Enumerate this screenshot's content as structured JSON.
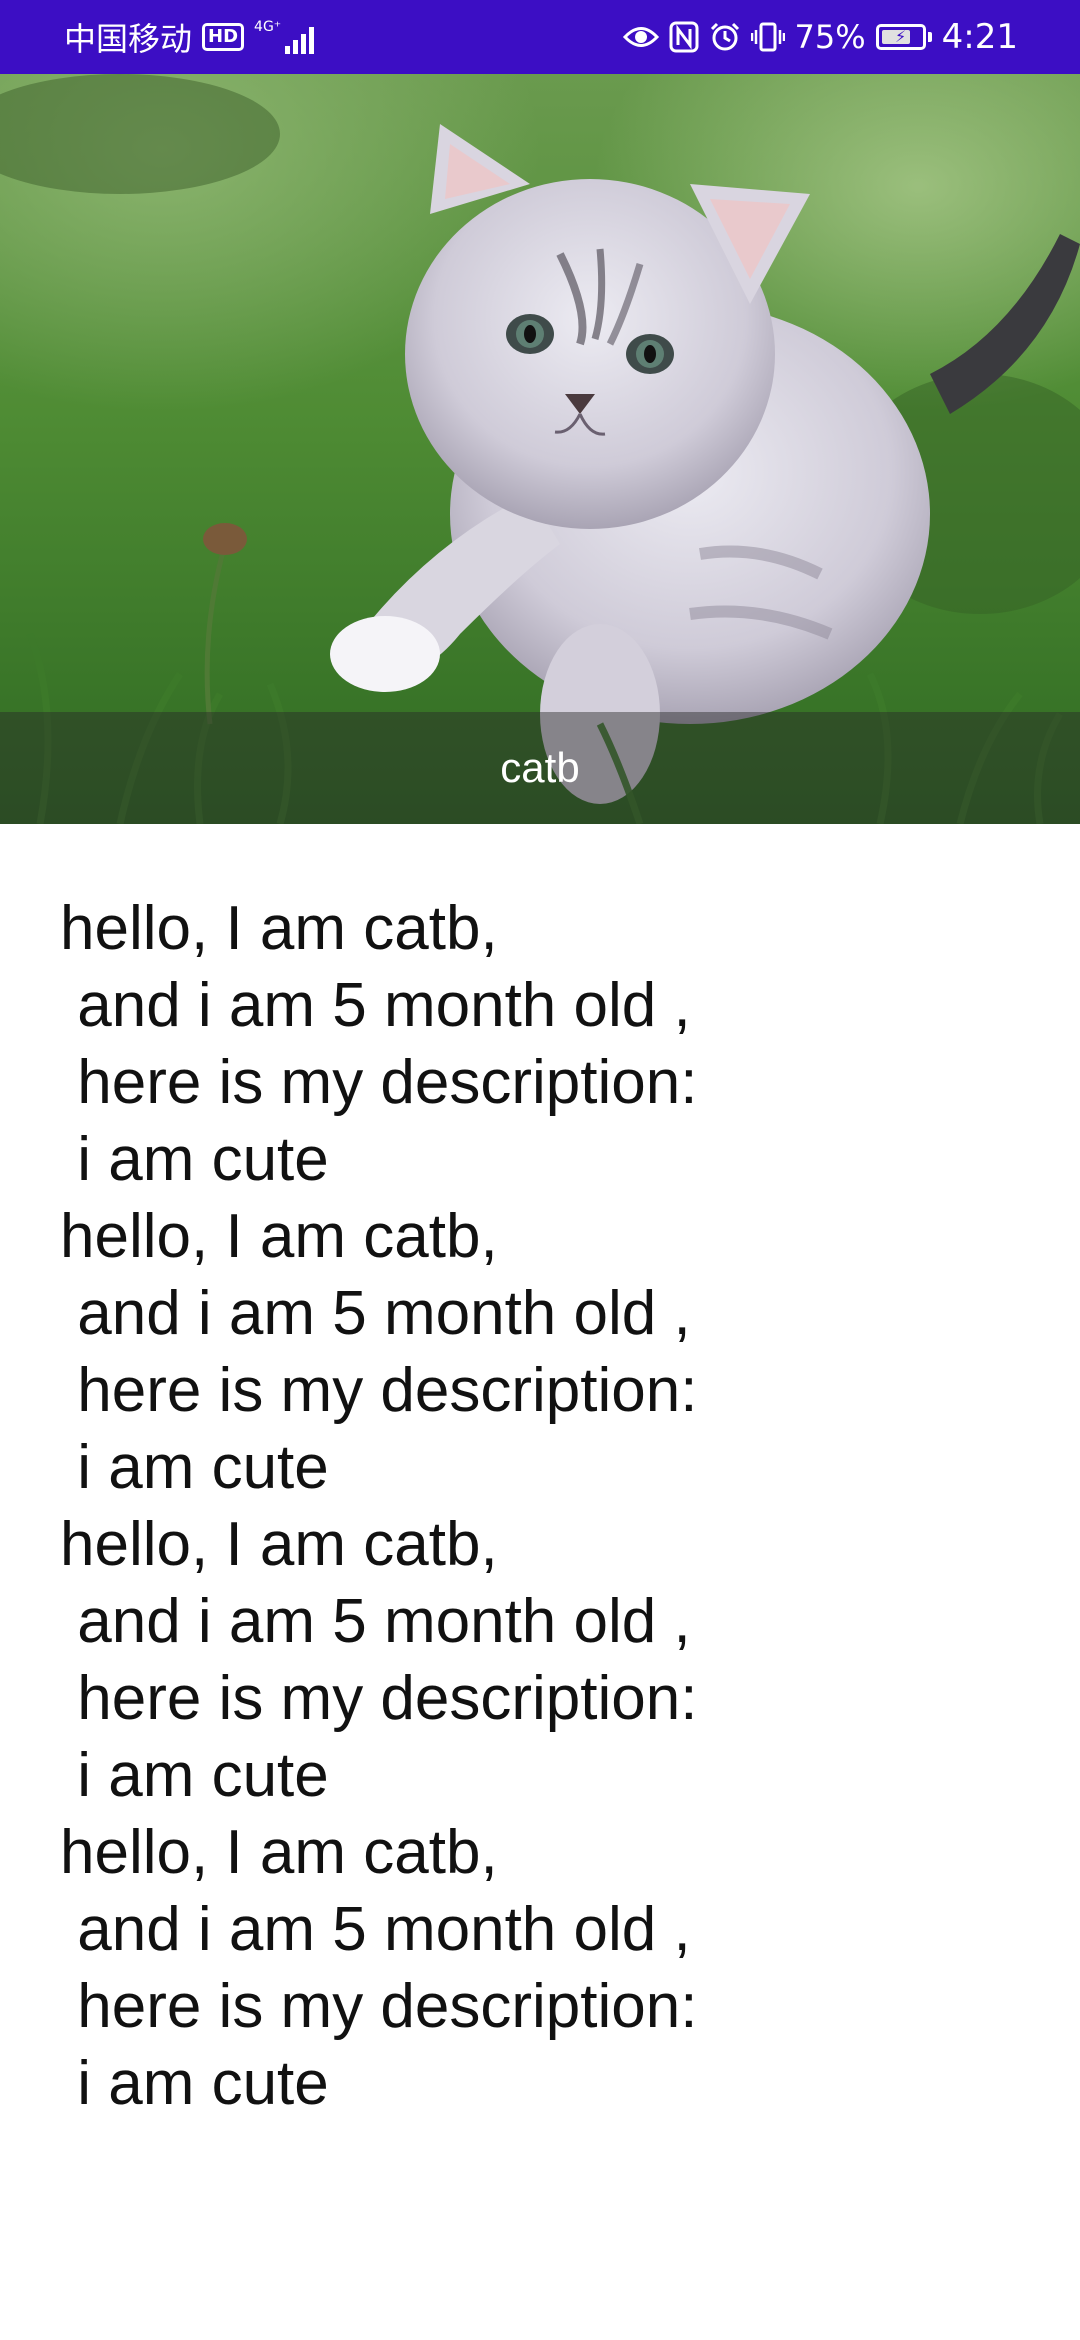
{
  "status_bar": {
    "carrier": "中国移动",
    "hd_badge": "HD",
    "network_type": "4G⁺",
    "battery_percent": "75%",
    "battery_level": 0.75,
    "time": "4:21",
    "background_color": "#3c0ec4"
  },
  "hero": {
    "image_subject": "kitten in grass",
    "caption": "catb"
  },
  "description": {
    "paragraphs": [
      {
        "line1": "hello, I am catb,",
        "line2": " and i am 5 month old ,",
        "line3": " here is my description:",
        "line4": " i am cute"
      },
      {
        "line1": "hello, I am catb,",
        "line2": " and i am 5 month old ,",
        "line3": " here is my description:",
        "line4": " i am cute"
      },
      {
        "line1": "hello, I am catb,",
        "line2": " and i am 5 month old ,",
        "line3": " here is my description:",
        "line4": " i am cute"
      },
      {
        "line1": "hello, I am catb,",
        "line2": " and i am 5 month old ,",
        "line3": " here is my description:",
        "line4": " i am cute"
      }
    ]
  }
}
